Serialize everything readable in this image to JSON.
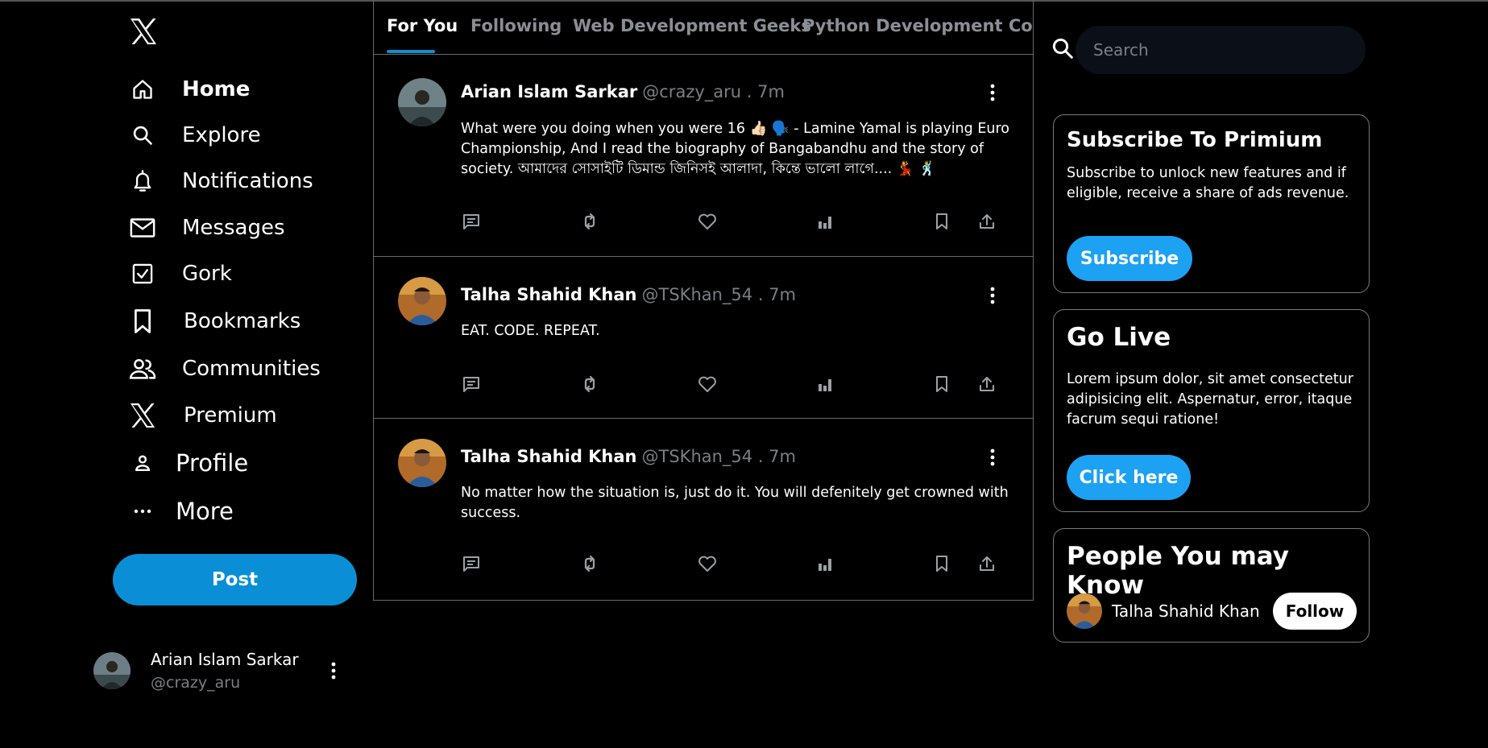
{
  "nav": {
    "items": [
      {
        "label": "Home",
        "icon": "home-icon"
      },
      {
        "label": "Explore",
        "icon": "search-icon"
      },
      {
        "label": "Notifications",
        "icon": "bell-icon"
      },
      {
        "label": "Messages",
        "icon": "mail-icon"
      },
      {
        "label": "Gork",
        "icon": "checkbox-icon"
      },
      {
        "label": "Bookmarks",
        "icon": "bookmark-icon"
      },
      {
        "label": "Communities",
        "icon": "people-icon"
      },
      {
        "label": "Premium",
        "icon": "x-logo-icon"
      },
      {
        "label": "Profile",
        "icon": "person-icon"
      },
      {
        "label": "More",
        "icon": "more-horizontal-icon"
      }
    ],
    "post_label": "Post"
  },
  "account": {
    "name": "Arian Islam Sarkar",
    "handle": "@crazy_aru"
  },
  "tabs": [
    {
      "label": "For You"
    },
    {
      "label": "Following"
    },
    {
      "label": "Web Development Geeks"
    },
    {
      "label": "Python Development Comm"
    }
  ],
  "tweets": [
    {
      "name": "Arian Islam Sarkar",
      "meta": "@crazy_aru . 7m",
      "text": "What were you doing when you were 16 👍🏻 🗣️ - Lamine Yamal is playing Euro Championship, And I read the biography of Bangabandhu and the story of society. আমাদের সোসাইটি ডিমান্ড জিনিসই আলাদা, কিন্তে ভালো লাগে.... 💃 🕺"
    },
    {
      "name": "Talha Shahid Khan",
      "meta": "@TSKhan_54 . 7m",
      "text": "EAT. CODE. REPEAT."
    },
    {
      "name": "Talha Shahid Khan",
      "meta": "@TSKhan_54 . 7m",
      "text": "No matter how the situation is, just do it. You will defenitely get crowned with success."
    }
  ],
  "search": {
    "placeholder": "Search"
  },
  "premium": {
    "title": "Subscribe To Primium",
    "text": "Subscribe to unlock new features and if eligible, receive a share of ads revenue.",
    "button": "Subscribe"
  },
  "live": {
    "title": "Go Live",
    "text": "Lorem ipsum dolor, sit amet consectetur adipisicing elit. Aspernatur, error, itaque facrum sequi ratione!",
    "button": "Click here"
  },
  "people": {
    "title": "People You may Know",
    "person_name": "Talha Shahid Khan",
    "follow_label": "Follow"
  },
  "colors": {
    "accent": "#0a8fd6",
    "pill": "#1da1f2",
    "border": "#6a6a6a",
    "muted": "#7b7f84"
  }
}
